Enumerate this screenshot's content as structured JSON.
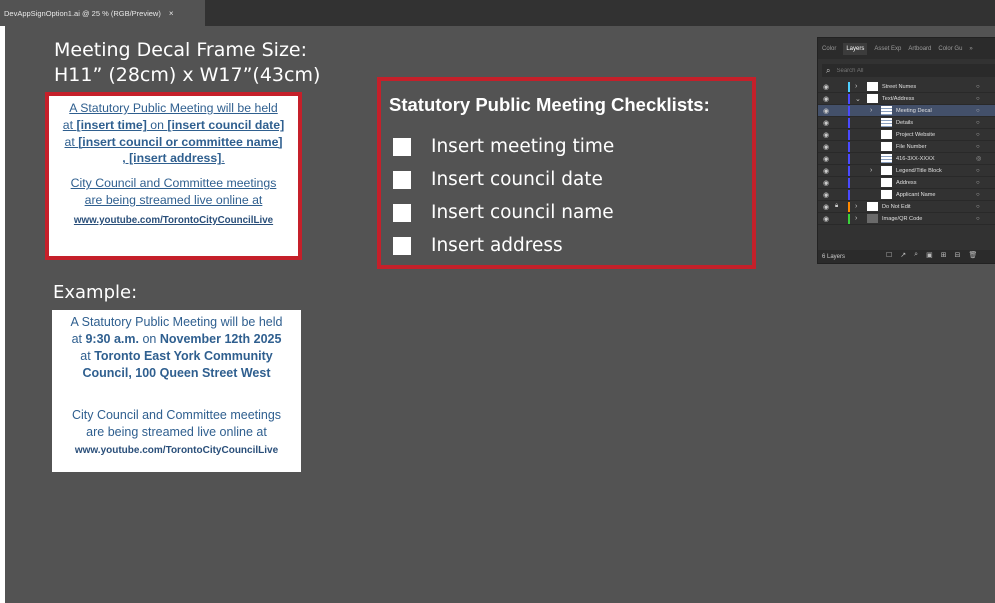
{
  "app": {
    "doc_tab": "DevAppSignOption1.ai @ 25 % (RGB/Preview)",
    "close_glyph": "×"
  },
  "frame_size": {
    "line1": "Meeting Decal Frame Size:",
    "line2": "H11” (28cm) x W17”(43cm)"
  },
  "decal": {
    "line1": "A Statutory Public Meeting will be held",
    "line2_pre": "at ",
    "line2_time": "[insert time]",
    "line2_mid": " on ",
    "line2_date": "[insert council date]",
    "line3_pre": "at ",
    "line3_name": "[insert council or committee name]",
    "line4_address": ", [insert address]",
    "line4_post": ".",
    "stream1": "City Council and Committee meetings",
    "stream2": "are being streamed live online at",
    "url": "www.youtube.com/TorontoCityCouncilLive"
  },
  "example": {
    "label": "Example:",
    "line1": "A Statutory Public Meeting will be held",
    "line2_pre": "at ",
    "line2_time": "9:30 a.m.",
    "line2_mid": " on ",
    "line2_date": "November 12th 2025",
    "line3_pre": "at ",
    "line3_name": "Toronto East York Community",
    "line4": "Council, 100 Queen Street West",
    "stream1": "City Council and Committee meetings",
    "stream2": "are being streamed live online at",
    "url": "www.youtube.com/TorontoCityCouncilLive"
  },
  "checklist": {
    "title": "Statutory Public Meeting Checklists:",
    "items": [
      "Insert meeting time",
      "Insert council date",
      "Insert council name",
      "Insert address"
    ]
  },
  "layers_panel": {
    "tabs": [
      "Color",
      "Layers",
      "Asset Exp",
      "Artboard",
      "Color Gu",
      "»"
    ],
    "active_tab": "Layers",
    "search_placeholder": "Search All",
    "rows": [
      {
        "name": "Street Numes",
        "color": "#4fd0ff"
      },
      {
        "name": "Text/Address",
        "color": "#4a4aff"
      },
      {
        "name": "Meeting Decal",
        "color": "#4a4aff",
        "selected": true
      },
      {
        "name": "Details",
        "color": "#4a4aff"
      },
      {
        "name": "Project Website",
        "color": "#4a4aff"
      },
      {
        "name": "File Number",
        "color": "#4a4aff"
      },
      {
        "name": "416-3XX-XXXX",
        "color": "#4a4aff"
      },
      {
        "name": "Legend/Title Block",
        "color": "#4a4aff"
      },
      {
        "name": "Address",
        "color": "#4a4aff"
      },
      {
        "name": "Applicant Name",
        "color": "#4a4aff"
      },
      {
        "name": "Do Not Edit",
        "color": "#ff8a00"
      },
      {
        "name": "Image/QR Code",
        "color": "#3ad23a"
      }
    ],
    "footer_count": "6 Layers"
  }
}
